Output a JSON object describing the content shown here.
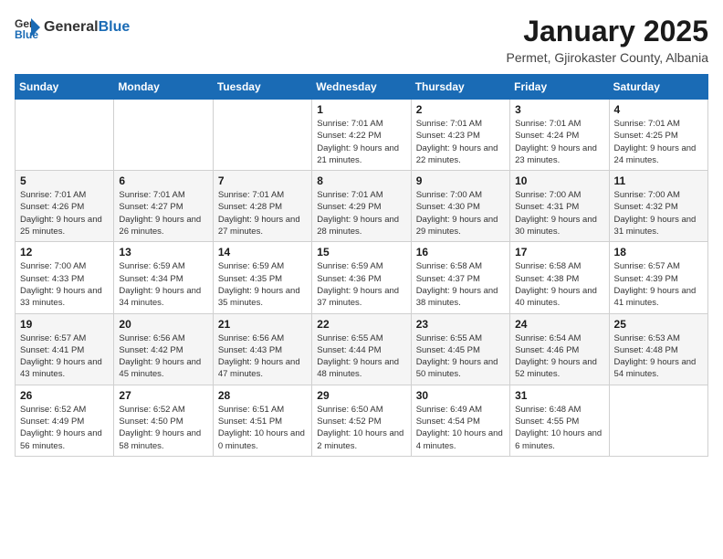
{
  "header": {
    "logo_general": "General",
    "logo_blue": "Blue",
    "month_title": "January 2025",
    "location": "Permet, Gjirokaster County, Albania"
  },
  "days_of_week": [
    "Sunday",
    "Monday",
    "Tuesday",
    "Wednesday",
    "Thursday",
    "Friday",
    "Saturday"
  ],
  "weeks": [
    [
      {
        "day": "",
        "info": ""
      },
      {
        "day": "",
        "info": ""
      },
      {
        "day": "",
        "info": ""
      },
      {
        "day": "1",
        "info": "Sunrise: 7:01 AM\nSunset: 4:22 PM\nDaylight: 9 hours and 21 minutes."
      },
      {
        "day": "2",
        "info": "Sunrise: 7:01 AM\nSunset: 4:23 PM\nDaylight: 9 hours and 22 minutes."
      },
      {
        "day": "3",
        "info": "Sunrise: 7:01 AM\nSunset: 4:24 PM\nDaylight: 9 hours and 23 minutes."
      },
      {
        "day": "4",
        "info": "Sunrise: 7:01 AM\nSunset: 4:25 PM\nDaylight: 9 hours and 24 minutes."
      }
    ],
    [
      {
        "day": "5",
        "info": "Sunrise: 7:01 AM\nSunset: 4:26 PM\nDaylight: 9 hours and 25 minutes."
      },
      {
        "day": "6",
        "info": "Sunrise: 7:01 AM\nSunset: 4:27 PM\nDaylight: 9 hours and 26 minutes."
      },
      {
        "day": "7",
        "info": "Sunrise: 7:01 AM\nSunset: 4:28 PM\nDaylight: 9 hours and 27 minutes."
      },
      {
        "day": "8",
        "info": "Sunrise: 7:01 AM\nSunset: 4:29 PM\nDaylight: 9 hours and 28 minutes."
      },
      {
        "day": "9",
        "info": "Sunrise: 7:00 AM\nSunset: 4:30 PM\nDaylight: 9 hours and 29 minutes."
      },
      {
        "day": "10",
        "info": "Sunrise: 7:00 AM\nSunset: 4:31 PM\nDaylight: 9 hours and 30 minutes."
      },
      {
        "day": "11",
        "info": "Sunrise: 7:00 AM\nSunset: 4:32 PM\nDaylight: 9 hours and 31 minutes."
      }
    ],
    [
      {
        "day": "12",
        "info": "Sunrise: 7:00 AM\nSunset: 4:33 PM\nDaylight: 9 hours and 33 minutes."
      },
      {
        "day": "13",
        "info": "Sunrise: 6:59 AM\nSunset: 4:34 PM\nDaylight: 9 hours and 34 minutes."
      },
      {
        "day": "14",
        "info": "Sunrise: 6:59 AM\nSunset: 4:35 PM\nDaylight: 9 hours and 35 minutes."
      },
      {
        "day": "15",
        "info": "Sunrise: 6:59 AM\nSunset: 4:36 PM\nDaylight: 9 hours and 37 minutes."
      },
      {
        "day": "16",
        "info": "Sunrise: 6:58 AM\nSunset: 4:37 PM\nDaylight: 9 hours and 38 minutes."
      },
      {
        "day": "17",
        "info": "Sunrise: 6:58 AM\nSunset: 4:38 PM\nDaylight: 9 hours and 40 minutes."
      },
      {
        "day": "18",
        "info": "Sunrise: 6:57 AM\nSunset: 4:39 PM\nDaylight: 9 hours and 41 minutes."
      }
    ],
    [
      {
        "day": "19",
        "info": "Sunrise: 6:57 AM\nSunset: 4:41 PM\nDaylight: 9 hours and 43 minutes."
      },
      {
        "day": "20",
        "info": "Sunrise: 6:56 AM\nSunset: 4:42 PM\nDaylight: 9 hours and 45 minutes."
      },
      {
        "day": "21",
        "info": "Sunrise: 6:56 AM\nSunset: 4:43 PM\nDaylight: 9 hours and 47 minutes."
      },
      {
        "day": "22",
        "info": "Sunrise: 6:55 AM\nSunset: 4:44 PM\nDaylight: 9 hours and 48 minutes."
      },
      {
        "day": "23",
        "info": "Sunrise: 6:55 AM\nSunset: 4:45 PM\nDaylight: 9 hours and 50 minutes."
      },
      {
        "day": "24",
        "info": "Sunrise: 6:54 AM\nSunset: 4:46 PM\nDaylight: 9 hours and 52 minutes."
      },
      {
        "day": "25",
        "info": "Sunrise: 6:53 AM\nSunset: 4:48 PM\nDaylight: 9 hours and 54 minutes."
      }
    ],
    [
      {
        "day": "26",
        "info": "Sunrise: 6:52 AM\nSunset: 4:49 PM\nDaylight: 9 hours and 56 minutes."
      },
      {
        "day": "27",
        "info": "Sunrise: 6:52 AM\nSunset: 4:50 PM\nDaylight: 9 hours and 58 minutes."
      },
      {
        "day": "28",
        "info": "Sunrise: 6:51 AM\nSunset: 4:51 PM\nDaylight: 10 hours and 0 minutes."
      },
      {
        "day": "29",
        "info": "Sunrise: 6:50 AM\nSunset: 4:52 PM\nDaylight: 10 hours and 2 minutes."
      },
      {
        "day": "30",
        "info": "Sunrise: 6:49 AM\nSunset: 4:54 PM\nDaylight: 10 hours and 4 minutes."
      },
      {
        "day": "31",
        "info": "Sunrise: 6:48 AM\nSunset: 4:55 PM\nDaylight: 10 hours and 6 minutes."
      },
      {
        "day": "",
        "info": ""
      }
    ]
  ]
}
